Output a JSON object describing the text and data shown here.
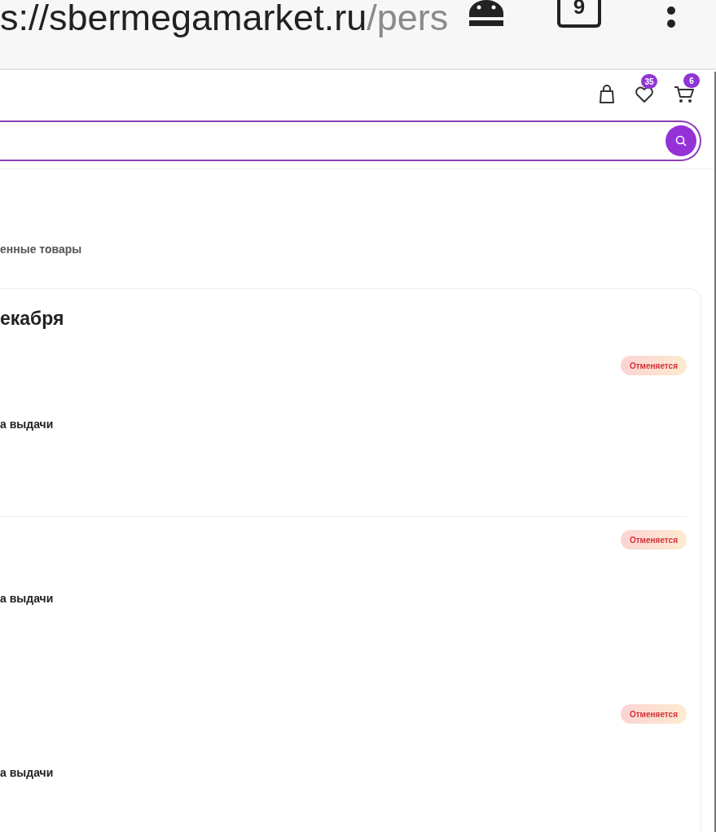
{
  "browser": {
    "url_host": "s://sbermegamarket.ru",
    "url_path": "/pers",
    "tab_count": "9"
  },
  "header": {
    "favorites_count": "35",
    "cart_count": "6"
  },
  "subtitle": "енные товары",
  "order_group": {
    "title": "екабря",
    "orders": [
      {
        "status": "Отменяется",
        "pickup": "а выдачи",
        "divider_after": true
      },
      {
        "status": "Отменяется",
        "pickup": "а выдачи",
        "divider_after": false
      },
      {
        "status": "Отменяется",
        "pickup": "а выдачи",
        "divider_after": false
      }
    ]
  }
}
